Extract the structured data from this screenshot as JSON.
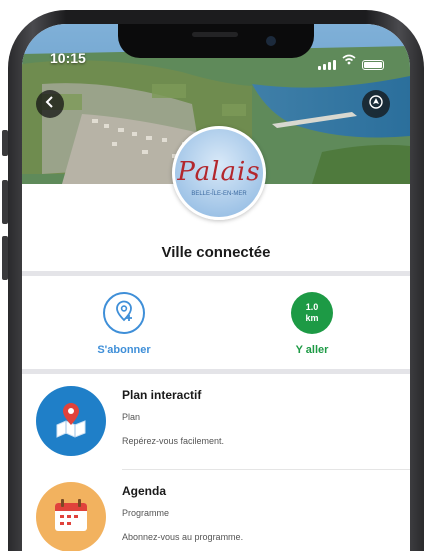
{
  "status": {
    "time": "10:15"
  },
  "hero": {
    "logo_title": "Palais",
    "logo_sub": "BELLE-ÎLE-EN-MER"
  },
  "page": {
    "title": "Ville connectée"
  },
  "actions": {
    "subscribe_label": "S'abonner",
    "goto_label": "Y aller",
    "distance_value": "1.0",
    "distance_unit": "km"
  },
  "list": [
    {
      "title": "Plan interactif",
      "subtitle": "Plan",
      "description": "Repérez-vous facilement.",
      "icon": "map-pin-icon"
    },
    {
      "title": "Agenda",
      "subtitle": "Programme",
      "description": "Abonnez-vous au programme.",
      "icon": "calendar-icon"
    }
  ],
  "colors": {
    "accent_blue": "#3f8fd8",
    "accent_green": "#1d9a45",
    "plan_bg": "#1f7fc8",
    "agenda_bg": "#f2b25f"
  }
}
